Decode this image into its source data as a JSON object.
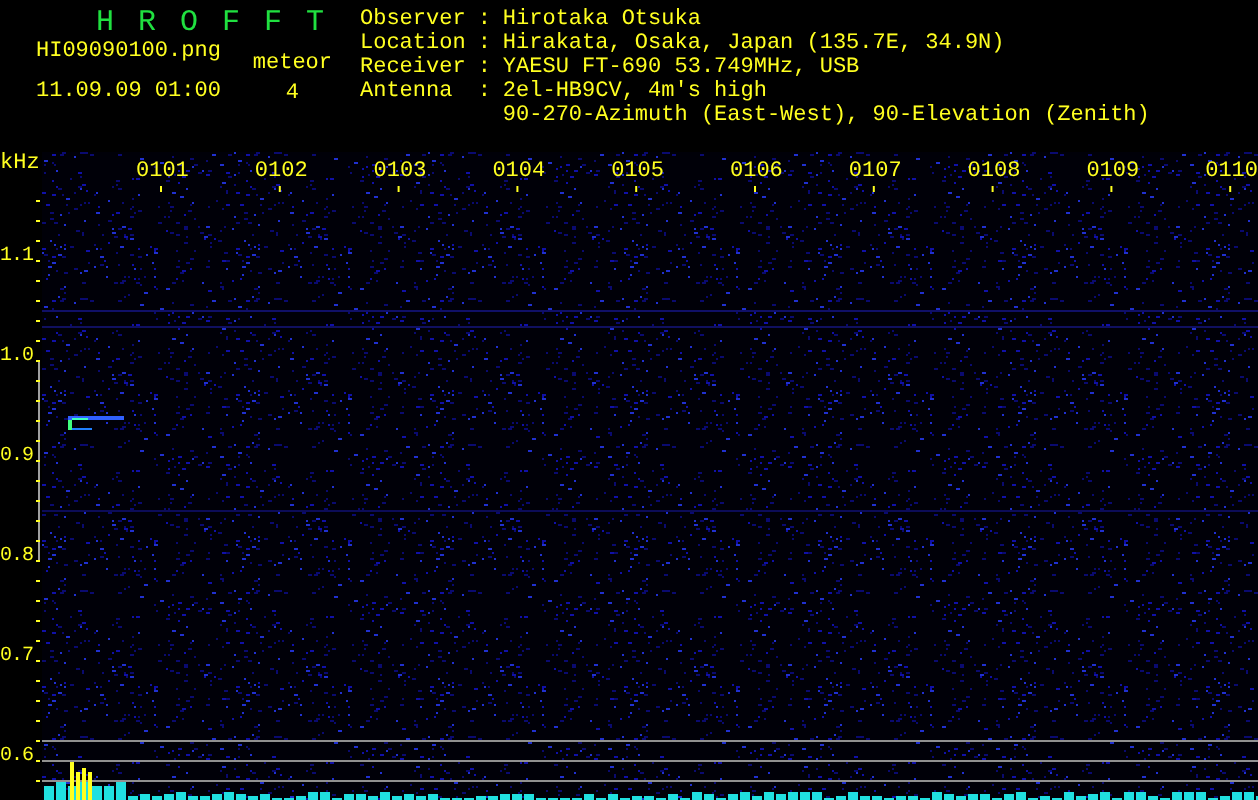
{
  "header": {
    "title": "H R O F F T",
    "filename": "HI09090100.png",
    "datetime": "11.09.09 01:00",
    "count_label": "meteor",
    "count": "4"
  },
  "info": [
    {
      "label": "Observer",
      "separator": ":",
      "lines": [
        "Hirotaka Otsuka"
      ]
    },
    {
      "label": "Location",
      "separator": ":",
      "lines": [
        "Hirakata, Osaka, Japan (135.7E, 34.9N)"
      ]
    },
    {
      "label": "Receiver",
      "separator": ":",
      "lines": [
        "YAESU FT-690 53.749MHz, USB"
      ]
    },
    {
      "label": "Antenna",
      "separator": ":",
      "lines": [
        "2el-HB9CV, 4m's high",
        "90-270-Azimuth (East-West), 90-Elevation (Zenith)"
      ]
    }
  ],
  "spectrogram": {
    "unit": "kHz",
    "time_labels": [
      "0101",
      "0102",
      "0103",
      "0104",
      "0105",
      "0106",
      "0107",
      "0108",
      "0109",
      "0110"
    ],
    "freq_labels": [
      "1.1",
      "1.0",
      "0.9",
      "0.8",
      "0.7",
      "0.6"
    ]
  }
}
